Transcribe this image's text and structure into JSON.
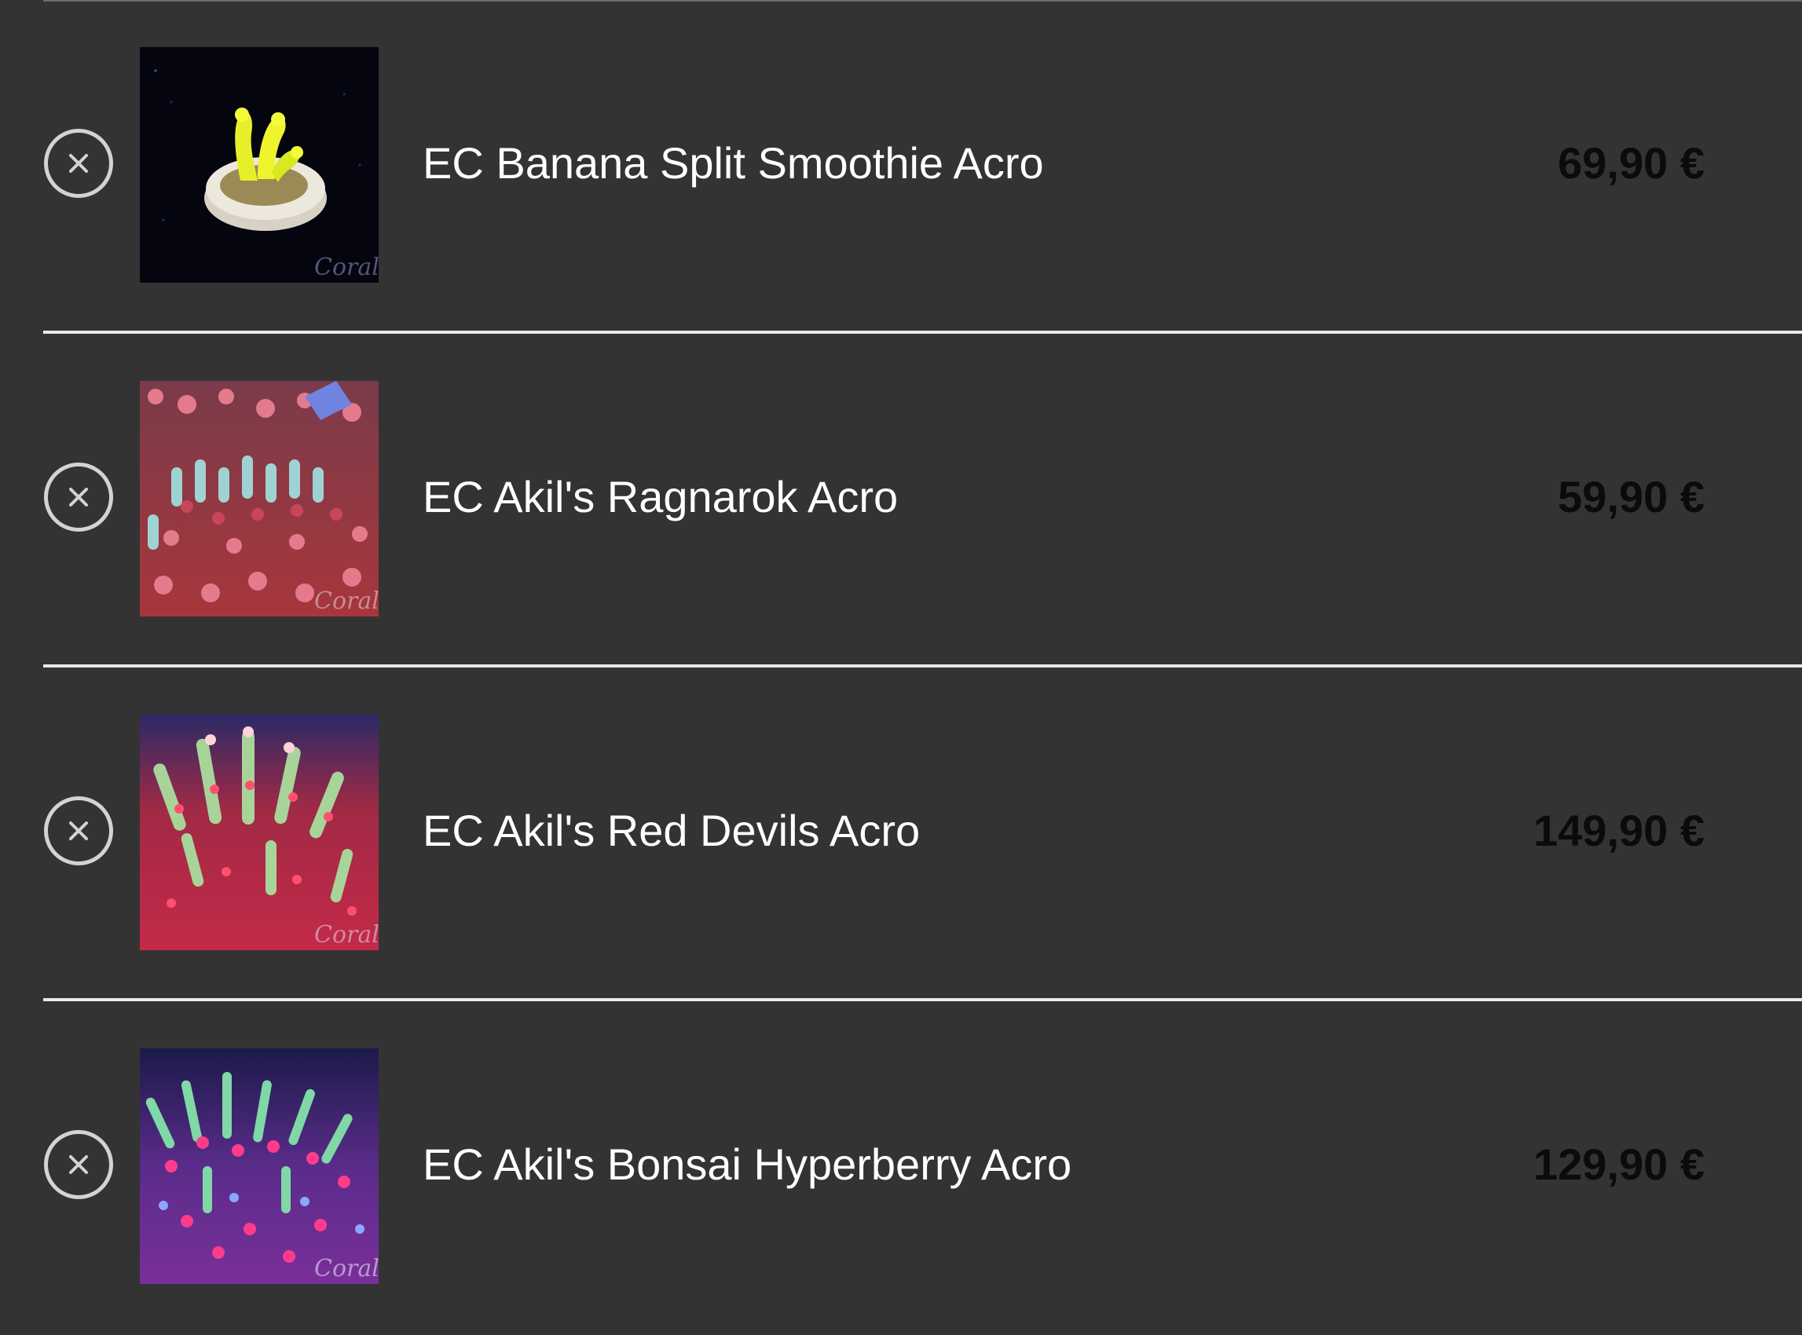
{
  "cart": {
    "items": [
      {
        "name": "EC Banana Split Smoothie Acro",
        "price": "69,90 €",
        "image_desc_icon": "coral-yellow-frag-photo"
      },
      {
        "name": "EC Akil's Ragnarok Acro",
        "price": "59,90 €",
        "image_desc_icon": "coral-pink-blue-colony-photo"
      },
      {
        "name": "EC Akil's Red Devils Acro",
        "price": "149,90 €",
        "image_desc_icon": "coral-red-green-colony-photo"
      },
      {
        "name": "EC Akil's Bonsai Hyperberry Acro",
        "price": "129,90 €",
        "image_desc_icon": "coral-purple-green-colony-photo"
      }
    ]
  },
  "colors": {
    "background": "#333333",
    "divider": "#e9e9e9",
    "remove_icon": "#d3d3d3",
    "name_text": "#ffffff",
    "price_text": "#0b0b0b"
  }
}
